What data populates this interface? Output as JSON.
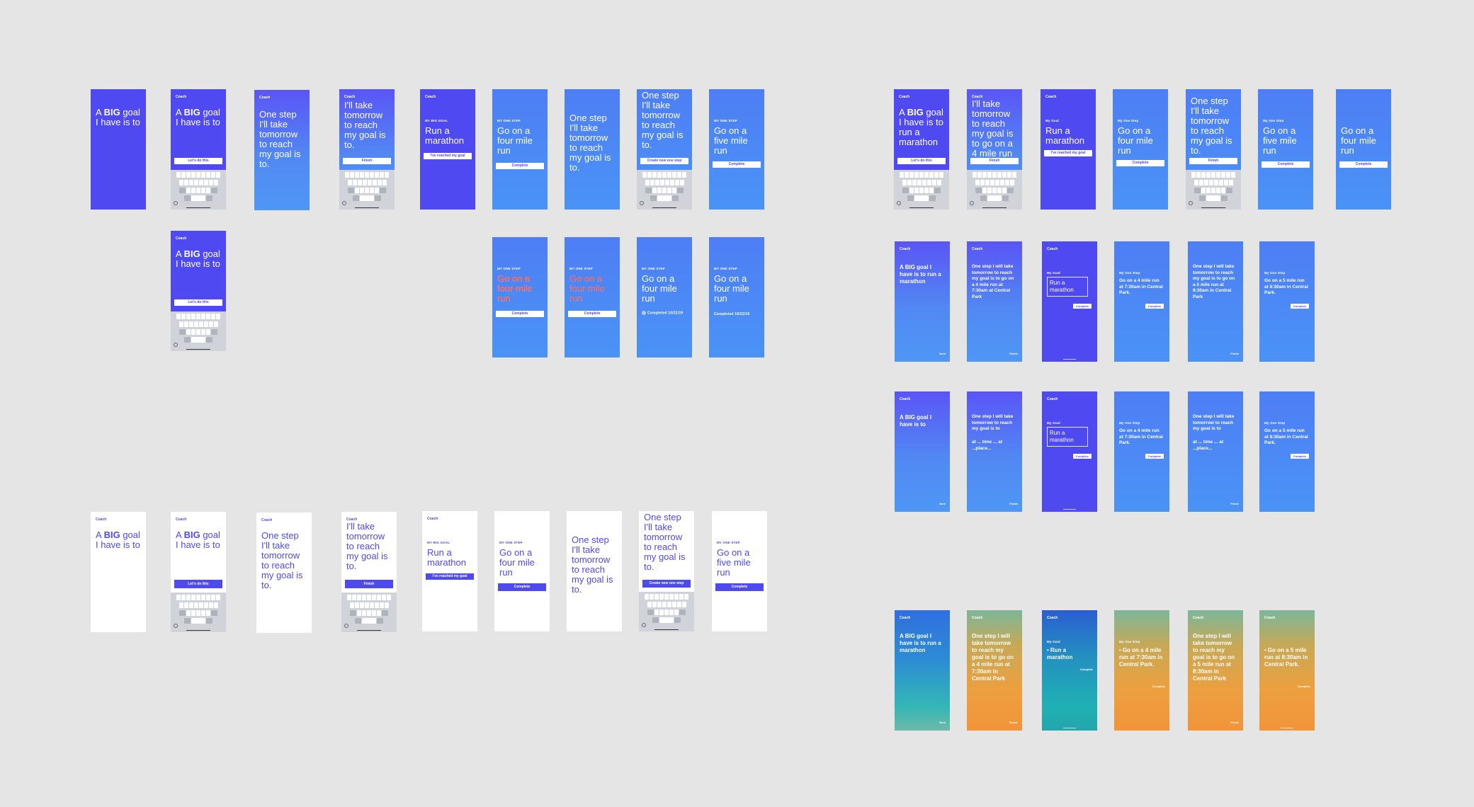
{
  "labels": {
    "artboard": "Board",
    "coach": "Coach",
    "lets_do_this": "Let's do this",
    "finish": "Finish",
    "complete": "Complete",
    "reached": "I've reached my goal",
    "create_step": "Create new one step",
    "my_big_goal": "MY BIG GOAL",
    "my_one_step": "MY ONE STEP",
    "my_goal": "My Goal",
    "my_one_step_sm": "My One Step",
    "next": "Next",
    "completed": "Completed 10/22/19",
    "space": "space"
  },
  "text": {
    "big_goal_pre": "A ",
    "big_goal_big": "BIG",
    "big_goal_post": " goal I have is to",
    "one_step": "One step I'll take tomorrow to reach my goal is to.",
    "ill_take": "I'll take tomorrow to reach my goal is to.",
    "run_marathon": "Run a marathon",
    "four_mile": "Go on a four mile run",
    "five_mile": "Go on a five mile run",
    "big_goal_run": " goal I have is to run a marathon",
    "ill_take_4mile": "I'll take tomorrow to reach my goal is to go on a 4 mile run",
    "big_goal_plain": "A BIG goal I have is to run a marathon",
    "big_goal_plain_short": "A BIG goal I have is to",
    "one_step_full_730": "One step I will take tomorrow to reach my goal is to go on a 4 mile run at 7:30am at Central Park",
    "go_4mile_730": "Go on a 4 mile run at 7:30am in Central Park.",
    "one_step_full_830": "One step I will take tomorrow to reach my goal is to go on a 5 mile run at 8:30am in Central Park",
    "go_5mile_830": "Go on a 5 mile run at 8:30am in Central Park.",
    "one_step_placeholder": "One step I will take tomorrow to reach my goal is to",
    "at_time": "at ... time ... at ...place...",
    "one_step_730_ci": "One step I will take tomorrow to reach my goal is to go on a 4 mile run at 7:30am in Central Park",
    "one_step_830_ci": "One step I will take tomorrow to reach my goal is to go on a 5 mile run at 8:30am in Central Park"
  }
}
